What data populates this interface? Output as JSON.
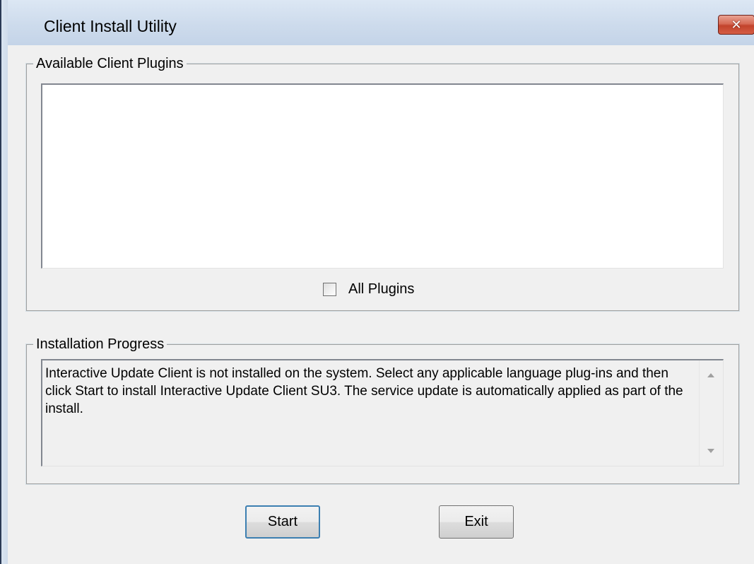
{
  "window": {
    "title": "Client Install Utility",
    "close_glyph": "✕",
    "icons": {
      "close": "close-icon"
    }
  },
  "plugins_group": {
    "legend": "Available Client Plugins",
    "items": [],
    "all_plugins_label": "All Plugins",
    "all_plugins_checked": false
  },
  "progress_group": {
    "legend": "Installation Progress",
    "message": "Interactive Update Client is not installed on the system. Select any applicable language plug-ins and then click Start to install Interactive Update Client SU3. The service update is automatically applied as part of the install."
  },
  "buttons": {
    "start": "Start",
    "exit": "Exit"
  },
  "colors": {
    "window_bg": "#f0f0f0",
    "close_button": "#c2432c",
    "focus_border": "#3c7fb1"
  }
}
